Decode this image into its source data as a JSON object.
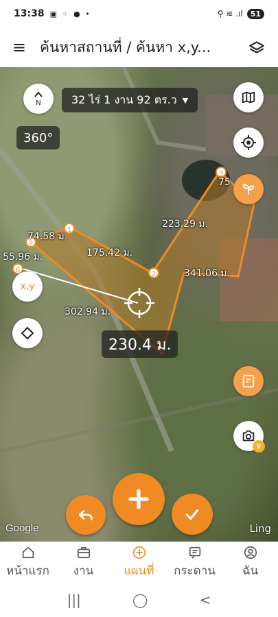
{
  "status_bar": {
    "time": "13:38",
    "left_icons": "▣ ⁘ ● •",
    "right_icons": "⚲ ≋ .ıl",
    "battery": "51"
  },
  "header": {
    "title": "ค้นหาสถานที่ / ค้นหา x,y...",
    "menu_icon": "hamburger-menu-icon",
    "layers_icon": "layers-icon"
  },
  "map": {
    "area_text": "32 ไร่ 1 งาน 92 ตร.ว",
    "heading": "360°",
    "distance": "230.4 ม.",
    "xy_button_label": "x,y",
    "segments": [
      {
        "label": "74.58 ม."
      },
      {
        "label": "175.42 ม."
      },
      {
        "label": "223.29 ม."
      },
      {
        "label": "341.06 ม."
      },
      {
        "label": "302.94 ม."
      },
      {
        "label": "55.96 ม."
      }
    ],
    "vertex_labels": [
      "1",
      "2",
      "3",
      "75",
      "6",
      "7"
    ],
    "google": "Google",
    "ling": "Ling"
  },
  "nav": {
    "items": [
      {
        "label": "หน้าแรก",
        "icon": "home-icon"
      },
      {
        "label": "งาน",
        "icon": "briefcase-icon"
      },
      {
        "label": "แผนที่",
        "icon": "map-plus-icon",
        "active": true
      },
      {
        "label": "กระดาน",
        "icon": "board-icon"
      },
      {
        "label": "ฉัน",
        "icon": "profile-icon"
      }
    ]
  },
  "colors": {
    "accent": "#f08a24",
    "polygon_fill": "#b07a2a",
    "polygon_stroke": "#f08a24"
  }
}
